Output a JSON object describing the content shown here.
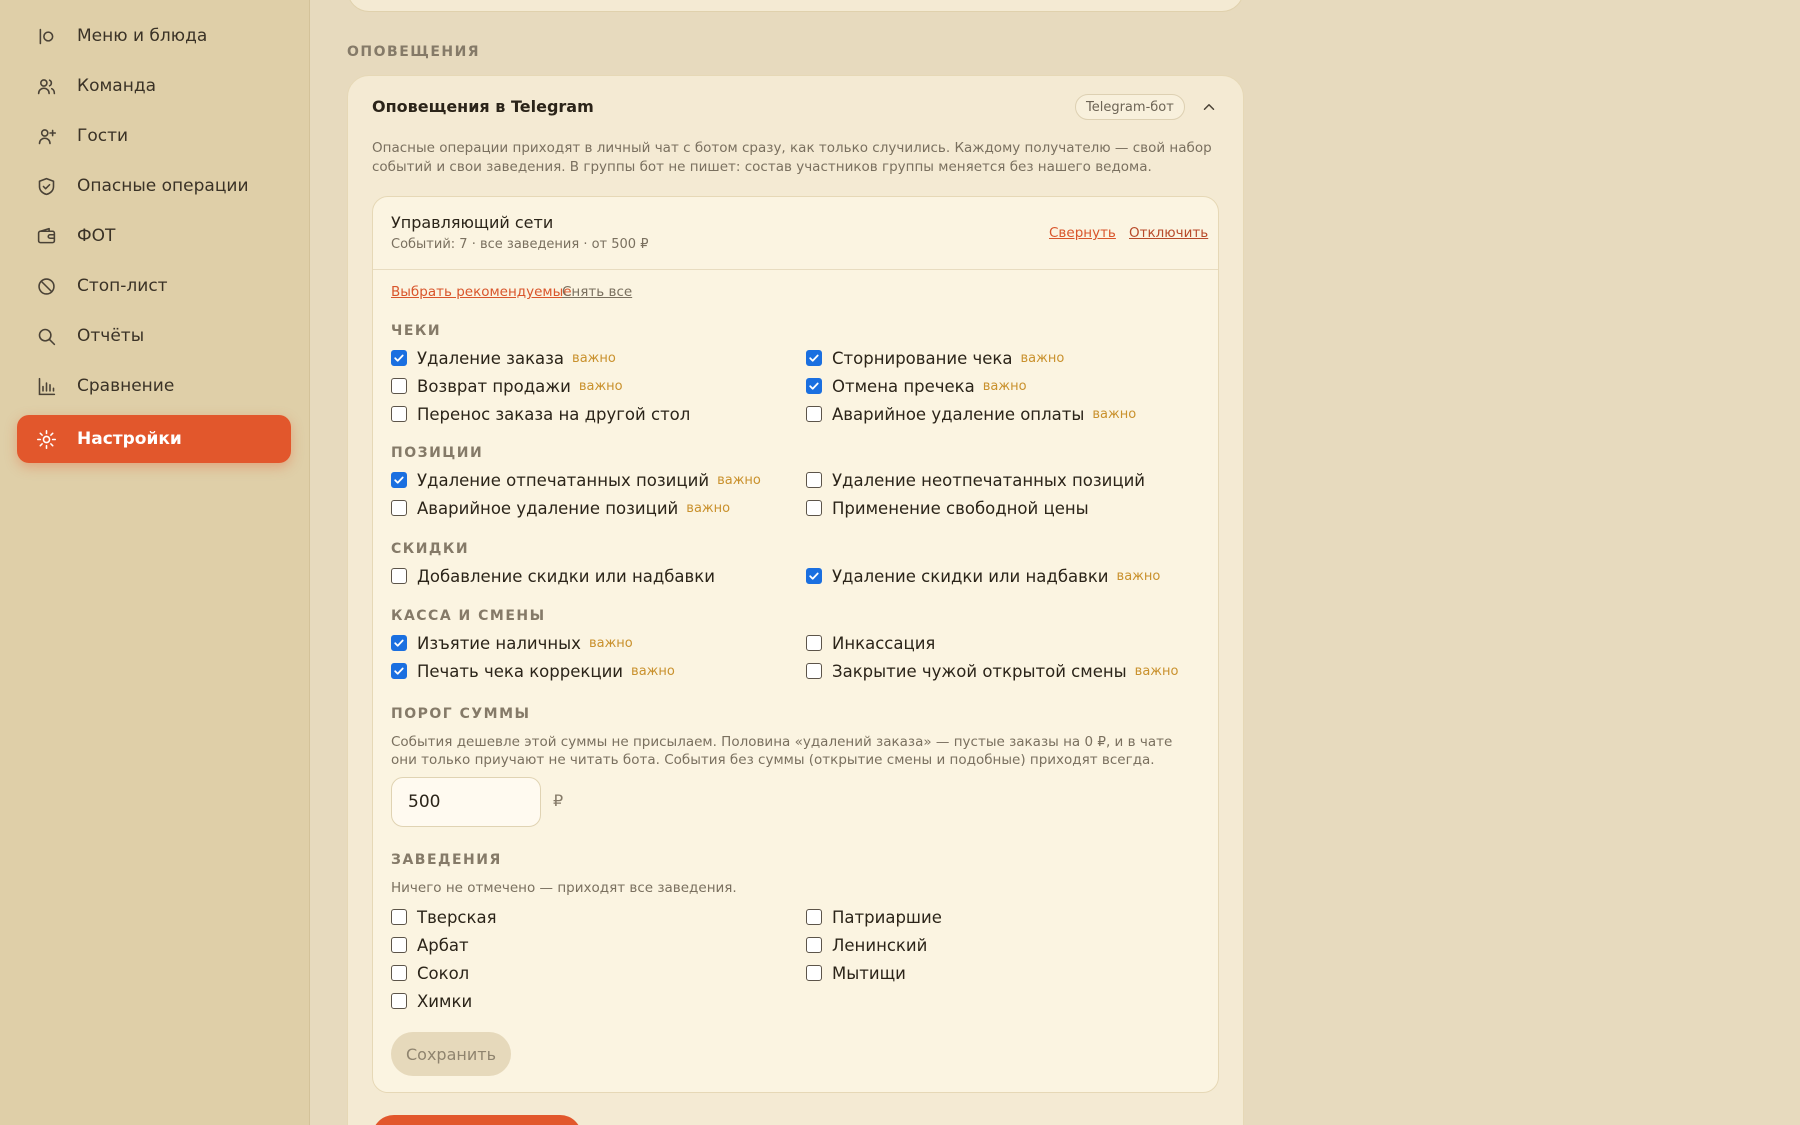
{
  "sidebar": {
    "items": [
      {
        "label": "Меню и блюда",
        "icon": "menu-dish-icon"
      },
      {
        "label": "Команда",
        "icon": "team-icon"
      },
      {
        "label": "Гости",
        "icon": "guests-icon"
      },
      {
        "label": "Опасные операции",
        "icon": "shield-icon"
      },
      {
        "label": "ФОТ",
        "icon": "wallet-icon"
      },
      {
        "label": "Стоп-лист",
        "icon": "stop-icon"
      },
      {
        "label": "Отчёты",
        "icon": "search-icon"
      },
      {
        "label": "Сравнение",
        "icon": "bar-chart-icon"
      },
      {
        "label": "Настройки",
        "icon": "gear-icon",
        "active": true
      }
    ]
  },
  "section_label": "ОПОВЕЩЕНИЯ",
  "telegram": {
    "title": "Оповещения в Telegram",
    "pill": "Telegram-бот",
    "description": "Опасные операции приходят в личный чат с ботом сразу, как только случились. Каждому получателю — свой набор событий и свои заведения. В группы бот не пишет: состав участников группы меняется без нашего ведома."
  },
  "recipient": {
    "title": "Управляющий сети",
    "subtitle": "Событий: 7 · все заведения · от 500 ₽",
    "collapse_link": "Свернуть",
    "disable_link": "Отключить",
    "select_recommended": "Выбрать рекомендуемые",
    "clear_all": "Снять все",
    "important_badge": "важно",
    "groups": {
      "checks": {
        "title": "ЧЕКИ",
        "left": [
          {
            "label": "Удаление заказа",
            "checked": true,
            "important": true
          },
          {
            "label": "Возврат продажи",
            "checked": false,
            "important": true
          },
          {
            "label": "Перенос заказа на другой стол",
            "checked": false,
            "important": false
          }
        ],
        "right": [
          {
            "label": "Сторнирование чека",
            "checked": true,
            "important": true
          },
          {
            "label": "Отмена пречека",
            "checked": true,
            "important": true
          },
          {
            "label": "Аварийное удаление оплаты",
            "checked": false,
            "important": true
          }
        ]
      },
      "positions": {
        "title": "ПОЗИЦИИ",
        "left": [
          {
            "label": "Удаление отпечатанных позиций",
            "checked": true,
            "important": true
          },
          {
            "label": "Аварийное удаление позиций",
            "checked": false,
            "important": true
          }
        ],
        "right": [
          {
            "label": "Удаление неотпечатанных позиций",
            "checked": false,
            "important": false
          },
          {
            "label": "Применение свободной цены",
            "checked": false,
            "important": false
          }
        ]
      },
      "discounts": {
        "title": "СКИДКИ",
        "left": [
          {
            "label": "Добавление скидки или надбавки",
            "checked": false,
            "important": false
          }
        ],
        "right": [
          {
            "label": "Удаление скидки или надбавки",
            "checked": true,
            "important": true
          }
        ]
      },
      "cash": {
        "title": "КАССА И СМЕНЫ",
        "left": [
          {
            "label": "Изъятие наличных",
            "checked": true,
            "important": true
          },
          {
            "label": "Печать чека коррекции",
            "checked": true,
            "important": true
          }
        ],
        "right": [
          {
            "label": "Инкассация",
            "checked": false,
            "important": false
          },
          {
            "label": "Закрытие чужой открытой смены",
            "checked": false,
            "important": true
          }
        ]
      }
    },
    "threshold": {
      "title": "ПОРОГ СУММЫ",
      "hint": "События дешевле этой суммы не присылаем. Половина «удалений заказа» — пустые заказы на 0 ₽, и в чате они только приучают не читать бота. События без суммы (открытие смены и подобные) приходят всегда.",
      "value": "500",
      "currency": "₽"
    },
    "venues": {
      "title": "ЗАВЕДЕНИЯ",
      "hint": "Ничего не отмечено — приходят все заведения.",
      "left": [
        {
          "label": "Тверская",
          "checked": false
        },
        {
          "label": "Арбат",
          "checked": false
        },
        {
          "label": "Сокол",
          "checked": false
        },
        {
          "label": "Химки",
          "checked": false
        }
      ],
      "right": [
        {
          "label": "Патриаршие",
          "checked": false
        },
        {
          "label": "Ленинский",
          "checked": false
        },
        {
          "label": "Мытищи",
          "checked": false
        }
      ]
    },
    "save_label": "Сохранить"
  },
  "colors": {
    "accent": "#e2572c",
    "important": "#c9912d",
    "checkbox_checked": "#1a6fe0"
  }
}
